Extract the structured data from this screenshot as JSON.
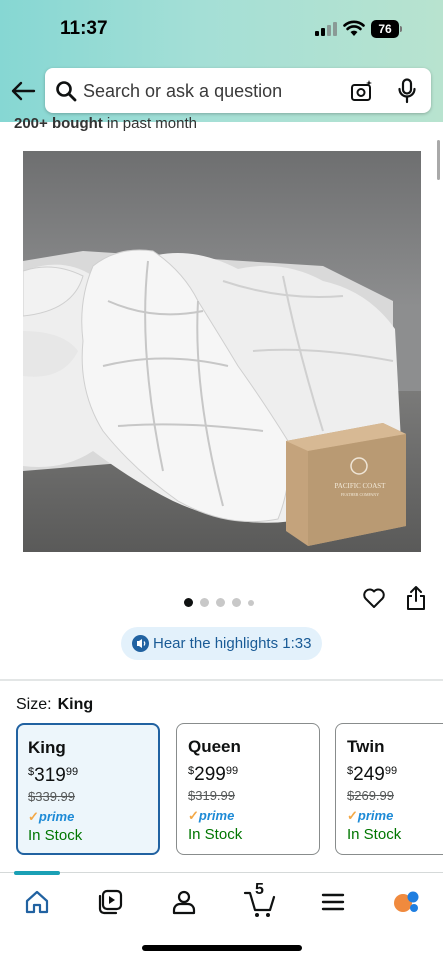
{
  "status_bar": {
    "time": "11:37",
    "battery": "76"
  },
  "search": {
    "placeholder": "Search or ask a question"
  },
  "social_proof": {
    "bold": "200+ bought",
    "rest": " in past month"
  },
  "product_image": {
    "box_text": "PACIFIC COAST",
    "box_subtext": "FEATHER COMPANY"
  },
  "carousel": {
    "page_count": 5,
    "active_index": 0
  },
  "audio": {
    "label": "Hear the highlights 1:33"
  },
  "size": {
    "label": "Size:",
    "selected": "King",
    "options": [
      {
        "name": "King",
        "currency": "$",
        "price_whole": "319",
        "price_fraction": "99",
        "list_price": "$339.99",
        "prime": "prime",
        "stock": "In Stock"
      },
      {
        "name": "Queen",
        "currency": "$",
        "price_whole": "299",
        "price_fraction": "99",
        "list_price": "$319.99",
        "prime": "prime",
        "stock": "In Stock"
      },
      {
        "name": "Twin",
        "currency": "$",
        "price_whole": "249",
        "price_fraction": "99",
        "list_price": "$269.99",
        "prime": "prime",
        "stock": "In Stock"
      }
    ]
  },
  "bottom_nav": {
    "cart_count": "5"
  },
  "colors": {
    "accent": "#2162a1",
    "prime": "#1d8ad6",
    "stock": "#007600",
    "header_gradient_start": "#86d7d3",
    "nav_indicator": "#1aa0b5"
  }
}
